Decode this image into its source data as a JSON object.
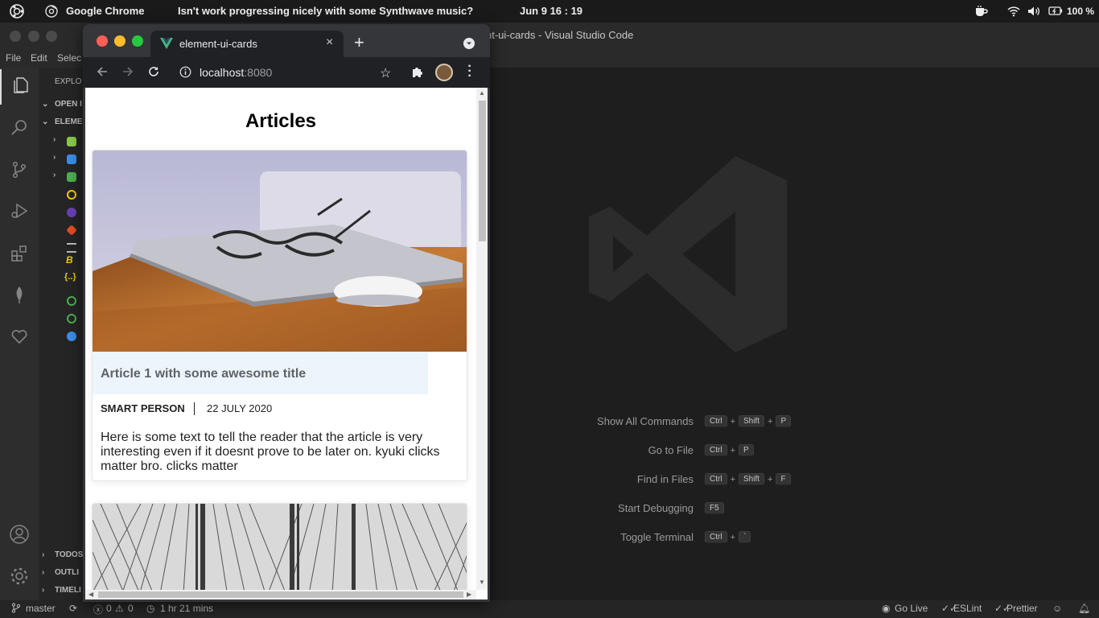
{
  "topbar": {
    "app_name": "Google Chrome",
    "window_title": "Isn't work progressing nicely with some Synthwave music?",
    "datetime": "Jun 9  16 : 19",
    "battery": "100 %"
  },
  "vscode": {
    "window_title": "element-ui-cards - Visual Studio Code",
    "title_visible": "nt-ui-cards - Visual Studio Code",
    "menu": {
      "file": "File",
      "edit": "Edit",
      "selection": "Selec"
    },
    "sidebar": {
      "explorer_label": "EXPLO",
      "open_editors_label": "OPEN I",
      "project_label": "ELEME",
      "todos_label": "TODOS",
      "outline_label": "OUTLI",
      "timeline_label": "TIMELI"
    },
    "welcome_hints": [
      {
        "label": "Show All Commands",
        "keys": [
          "Ctrl",
          "+",
          "Shift",
          "+",
          "P"
        ]
      },
      {
        "label": "Go to File",
        "keys": [
          "Ctrl",
          "+",
          "P"
        ]
      },
      {
        "label": "Find in Files",
        "keys": [
          "Ctrl",
          "+",
          "Shift",
          "+",
          "F"
        ]
      },
      {
        "label": "Start Debugging",
        "keys": [
          "F5"
        ]
      },
      {
        "label": "Toggle Terminal",
        "keys": [
          "Ctrl",
          "+",
          "`"
        ]
      }
    ],
    "status": {
      "branch": "master",
      "errors": "0",
      "warnings": "0",
      "time_tracked": "1 hr 21 mins",
      "go_live": "Go Live",
      "eslint": "ESLint",
      "prettier": "Prettier"
    }
  },
  "chrome": {
    "tab_title": "element-ui-cards",
    "url_host": "localhost",
    "url_port": ":8080"
  },
  "page": {
    "heading": "Articles",
    "cards": [
      {
        "title": "Article 1 with some awesome title",
        "author": "SMART PERSON",
        "date": "22 JULY 2020",
        "excerpt": "Here is some text to tell the reader that the article is very interesting even if it doesnt prove to be later on. kyuki clicks matter bro. clicks matter"
      }
    ]
  },
  "colors": {
    "vscode_bg": "#1e1e1e",
    "chrome_frame": "#35363a",
    "article_title_bg": "#ecf5fb",
    "mac_close": "#ff5f57",
    "mac_minimize": "#febc2e",
    "mac_zoom": "#28c840"
  }
}
